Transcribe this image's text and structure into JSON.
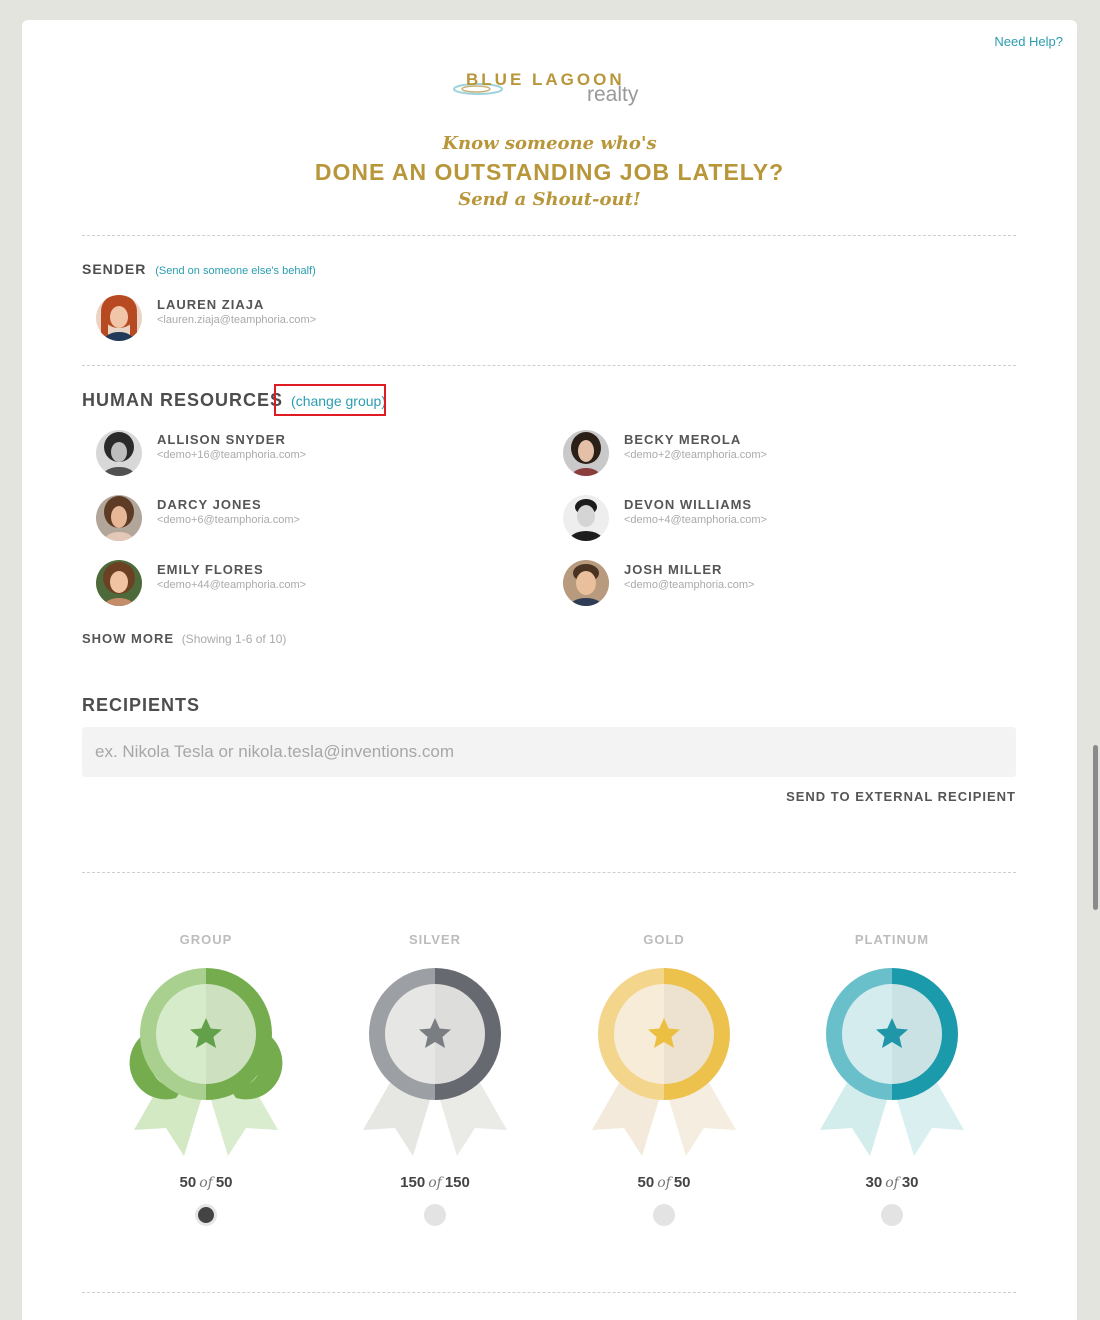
{
  "header": {
    "help_link": "Need Help?",
    "logo_line1": "BLUE LAGOON",
    "logo_line2": "realty",
    "headline_top": "Know someone who's",
    "headline_main": "DONE AN OUTSTANDING JOB LATELY?",
    "headline_bottom": "Send a Shout-out!"
  },
  "sender": {
    "title": "SENDER",
    "behalf_link": "(Send on someone else's behalf)",
    "name": "LAUREN ZIAJA",
    "email": "<lauren.ziaja@teamphoria.com>"
  },
  "group": {
    "title": "HUMAN RESOURCES",
    "change_link": "(change group)",
    "members": [
      {
        "name": "ALLISON SNYDER",
        "email": "<demo+16@teamphoria.com>"
      },
      {
        "name": "BECKY MEROLA",
        "email": "<demo+2@teamphoria.com>"
      },
      {
        "name": "DARCY JONES",
        "email": "<demo+6@teamphoria.com>"
      },
      {
        "name": "DEVON WILLIAMS",
        "email": "<demo+4@teamphoria.com>"
      },
      {
        "name": "EMILY FLORES",
        "email": "<demo+44@teamphoria.com>"
      },
      {
        "name": "JOSH MILLER",
        "email": "<demo@teamphoria.com>"
      }
    ],
    "show_more": "SHOW MORE",
    "showing": "(Showing 1-6 of 10)"
  },
  "recipients": {
    "title": "RECIPIENTS",
    "placeholder": "ex. Nikola Tesla or nikola.tesla@inventions.com",
    "value": "",
    "external_button": "SEND TO EXTERNAL RECIPIENT"
  },
  "awards": [
    {
      "label": "GROUP",
      "left": "50",
      "of": "of",
      "total": "50",
      "selected": true,
      "light": "#a9d08e",
      "dark": "#75ad4e",
      "inner": "#d6ebc9",
      "star": "#63a04a",
      "ribbon": "#d2e9c4"
    },
    {
      "label": "SILVER",
      "left": "150",
      "of": "of",
      "total": "150",
      "selected": false,
      "light": "#9c9fa3",
      "dark": "#666a70",
      "inner": "#e6e6e4",
      "star": "#7a7d82",
      "ribbon": "#e6e6e3"
    },
    {
      "label": "GOLD",
      "left": "50",
      "of": "of",
      "total": "50",
      "selected": false,
      "light": "#f3d58c",
      "dark": "#ecc24c",
      "inner": "#f6ecd8",
      "star": "#ebbf42",
      "ribbon": "#f3eadb"
    },
    {
      "label": "PLATINUM",
      "left": "30",
      "of": "of",
      "total": "30",
      "selected": false,
      "light": "#69c0cb",
      "dark": "#1a9aaa",
      "inner": "#d4ecee",
      "star": "#1f97a8",
      "ribbon": "#d3ecec"
    }
  ]
}
